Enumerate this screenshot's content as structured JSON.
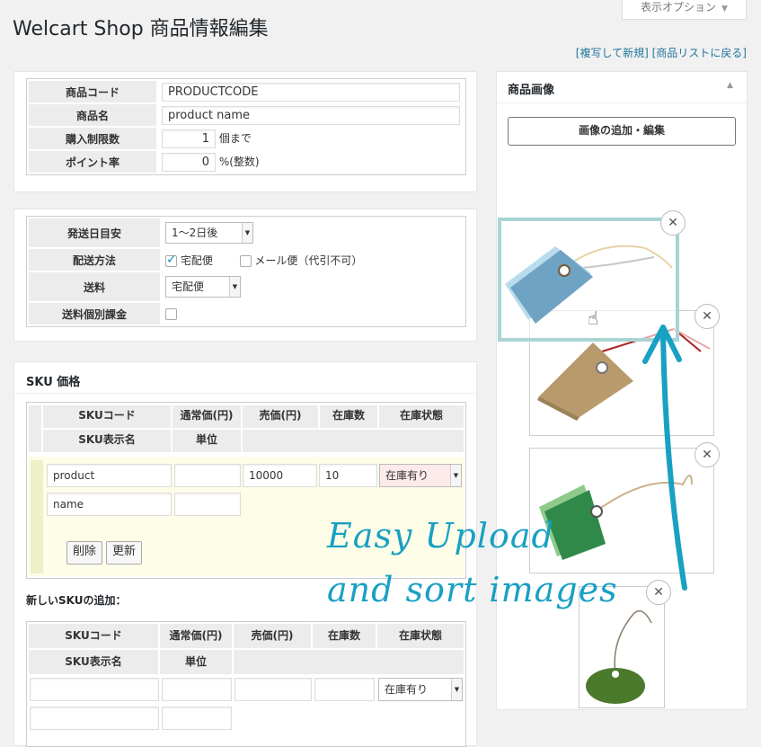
{
  "header": {
    "title": "Welcart Shop 商品情報編集",
    "screen_options": "表示オプション",
    "link_copy": "[複写して新規]",
    "link_list": "[商品リストに戻る]"
  },
  "basic": {
    "code_label": "商品コード",
    "code_value": "PRODUCTCODE",
    "name_label": "商品名",
    "name_value": "product name",
    "limit_label": "購入制限数",
    "limit_value": "1",
    "limit_suffix": "個まで",
    "point_label": "ポイント率",
    "point_value": "0",
    "point_suffix": "%(整数)"
  },
  "shipping": {
    "ship_date_label": "発送日目安",
    "ship_date_value": "1〜2日後",
    "method_label": "配送方法",
    "method_home": "宅配便",
    "method_home_checked": true,
    "method_mail": "メール便（代引不可）",
    "method_mail_checked": false,
    "fee_label": "送料",
    "fee_value": "宅配便",
    "individual_label": "送料個別課金",
    "individual_checked": false
  },
  "sku": {
    "section_title": "SKU 価格",
    "col_code": "SKUコード",
    "col_list_price": "通常価(円)",
    "col_price": "売価(円)",
    "col_stock": "在庫数",
    "col_status": "在庫状態",
    "col_display_name": "SKU表示名",
    "col_unit": "単位",
    "row_code": "product",
    "row_list_price": "",
    "row_price": "10000",
    "row_stock": "10",
    "row_status": "在庫有り",
    "row_name": "name",
    "row_unit": "",
    "delete_button": "削除",
    "update_button": "更新"
  },
  "new_sku": {
    "title": "新しいSKUの追加：",
    "col_code": "SKUコード",
    "col_list_price": "通常価(円)",
    "col_price": "売価(円)",
    "col_stock": "在庫数",
    "col_status": "在庫状態",
    "col_display_name": "SKU表示名",
    "col_unit": "単位",
    "status_value": "在庫有り"
  },
  "images": {
    "title": "商品画像",
    "add_button": "画像の追加・編集",
    "overlay_line1": "Easy Upload",
    "overlay_line2": "and sort images",
    "tags": [
      {
        "name": "blue-tag",
        "color": "#6ea3c3"
      },
      {
        "name": "brown-tag",
        "color": "#b89a6c"
      },
      {
        "name": "green-tag",
        "color": "#2f8a4a"
      },
      {
        "name": "round-green-tag",
        "color": "#4b7a2c"
      }
    ]
  },
  "colors": {
    "link": "#21759b",
    "accent_teal": "#19a0c3",
    "drag_outline": "#a9d4d4"
  }
}
